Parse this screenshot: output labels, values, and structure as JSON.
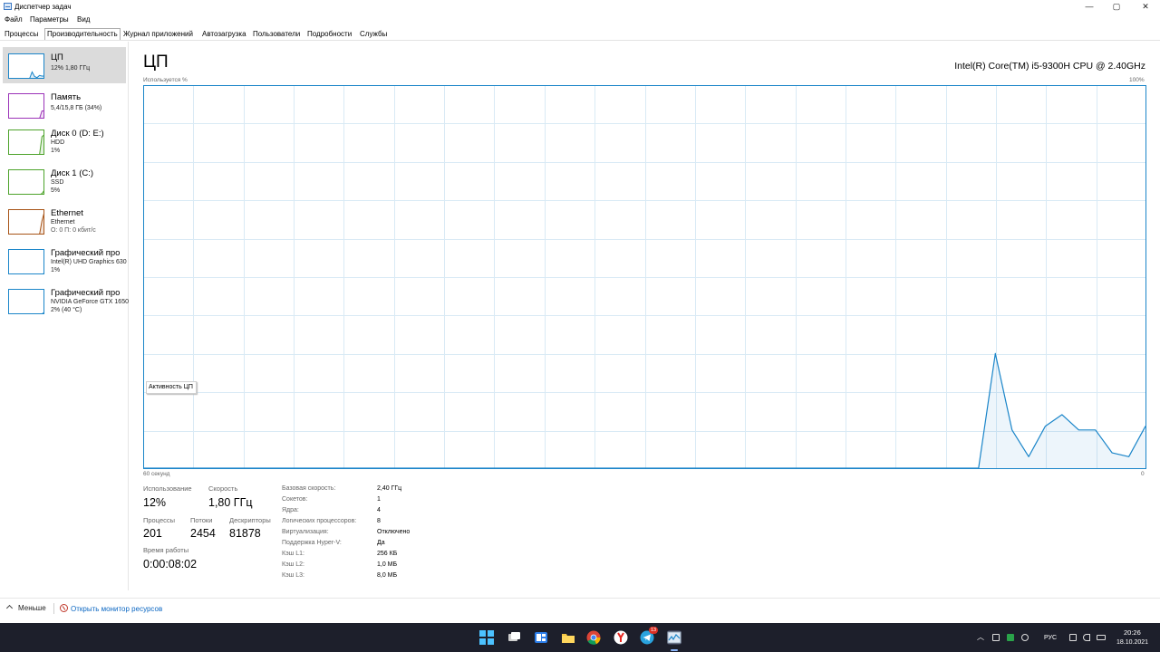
{
  "window": {
    "title": "Диспетчер задач",
    "controls": {
      "minimize": "—",
      "maximize": "▢",
      "close": "✕"
    }
  },
  "menu": [
    "Файл",
    "Параметры",
    "Вид"
  ],
  "tabs": [
    {
      "label": "Процессы",
      "active": false
    },
    {
      "label": "Производительность",
      "active": true
    },
    {
      "label": "Журнал приложений",
      "active": false
    },
    {
      "label": "Автозагрузка",
      "active": false
    },
    {
      "label": "Пользователи",
      "active": false
    },
    {
      "label": "Подробности",
      "active": false
    },
    {
      "label": "Службы",
      "active": false
    }
  ],
  "sidebar": {
    "items": [
      {
        "title": "ЦП",
        "sub1": "12% 1,80 ГГц",
        "sub2": "",
        "sub3": "",
        "color": "#1a85c9",
        "selected": true,
        "spark": [
          0,
          0,
          0,
          0,
          0,
          0,
          0,
          0,
          0.02,
          0.3,
          0.1,
          0.05,
          0.15,
          0.12,
          0.12
        ]
      },
      {
        "title": "Память",
        "sub1": "5,4/15,8 ГБ (34%)",
        "sub2": "",
        "sub3": "",
        "color": "#9b32b8",
        "selected": false,
        "spark": [
          0,
          0,
          0,
          0,
          0,
          0,
          0,
          0,
          0,
          0,
          0,
          0,
          0,
          0.34,
          0.34
        ]
      },
      {
        "title": "Диск 0 (D: E:)",
        "sub1": "HDD",
        "sub2": "1%",
        "sub3": "",
        "color": "#4da32a",
        "selected": false,
        "spark": [
          0,
          0,
          0,
          0,
          0,
          0,
          0,
          0,
          0,
          0,
          0,
          0,
          0,
          0.8,
          0.9
        ]
      },
      {
        "title": "Диск 1 (C:)",
        "sub1": "SSD",
        "sub2": "5%",
        "sub3": "",
        "color": "#4da32a",
        "selected": false,
        "spark": [
          0,
          0,
          0,
          0,
          0,
          0,
          0,
          0,
          0,
          0,
          0,
          0,
          0,
          0.05,
          0.2
        ]
      },
      {
        "title": "Ethernet",
        "sub1": "Ethernet",
        "sub2": "О: 0 П: 0 кбит/с",
        "sub3": "",
        "color": "#a75316",
        "selected": false,
        "spark": [
          0,
          0,
          0,
          0,
          0,
          0,
          0,
          0,
          0,
          0,
          0,
          0,
          0,
          0.6,
          1.0
        ]
      },
      {
        "title": "Графический про",
        "sub1": "Intel(R) UHD Graphics 630",
        "sub2": "1%",
        "sub3": "",
        "color": "#1a85c9",
        "selected": false,
        "spark": [
          0,
          0,
          0,
          0,
          0,
          0,
          0,
          0,
          0,
          0,
          0,
          0,
          0,
          0,
          0.05
        ]
      },
      {
        "title": "Графический про",
        "sub1": "NVIDIA GeForce GTX 1650",
        "sub2": "2% (40 °C)",
        "sub3": "",
        "color": "#1a85c9",
        "selected": false,
        "spark": [
          0,
          0,
          0,
          0,
          0,
          0,
          0,
          0,
          0,
          0,
          0,
          0,
          0,
          0.02,
          0.08
        ]
      }
    ]
  },
  "main": {
    "title": "ЦП",
    "cpu_model": "Intel(R) Core(TM) i5-9300H CPU @ 2.40GHz",
    "graph_top_left": "Используется %",
    "graph_top_right": "100%",
    "graph_bottom_left": "60 секунд",
    "graph_bottom_right": "0",
    "tooltip": "Активность ЦП",
    "accent": "#1a85c9",
    "grid_color": "#d9eaf5"
  },
  "chart_data": {
    "type": "area",
    "x": [
      60,
      59,
      58,
      57,
      56,
      55,
      54,
      53,
      52,
      51,
      50,
      49,
      48,
      47,
      46,
      45,
      44,
      43,
      42,
      41,
      40,
      39,
      38,
      37,
      36,
      35,
      34,
      33,
      32,
      31,
      30,
      29,
      28,
      27,
      26,
      25,
      24,
      23,
      22,
      21,
      20,
      19,
      18,
      17,
      16,
      15,
      14,
      13,
      12,
      11,
      10,
      9,
      8,
      7,
      6,
      5,
      4,
      3,
      2,
      1,
      0
    ],
    "series": [
      {
        "values": [
          0,
          0,
          0,
          0,
          0,
          0,
          0,
          0,
          0,
          0,
          0,
          0,
          0,
          0,
          0,
          0,
          0,
          0,
          0,
          0,
          0,
          0,
          0,
          0,
          0,
          0,
          0,
          0,
          0,
          0,
          0,
          0,
          0,
          0,
          0,
          0,
          0,
          0,
          0,
          0,
          0,
          0,
          0,
          0,
          0,
          0,
          0,
          0,
          0,
          0,
          0,
          30,
          10,
          3,
          11,
          14,
          10,
          10,
          4,
          3,
          11
        ]
      }
    ],
    "xlabel": "60 секунд",
    "ylabel": "Используется %",
    "ylim": [
      0,
      100
    ],
    "grid": true
  },
  "stats": {
    "usage_label": "Использование",
    "usage_value": "12%",
    "speed_label": "Скорость",
    "speed_value": "1,80 ГГц",
    "processes_label": "Процессы",
    "processes_value": "201",
    "threads_label": "Потоки",
    "threads_value": "2454",
    "handles_label": "Дескрипторы",
    "handles_value": "81878",
    "uptime_label": "Время работы",
    "uptime_value": "0:00:08:02"
  },
  "details": [
    {
      "key": "Базовая скорость:",
      "value": "2,40 ГГц"
    },
    {
      "key": "Сокетов:",
      "value": "1"
    },
    {
      "key": "Ядра:",
      "value": "4"
    },
    {
      "key": "Логических процессоров:",
      "value": "8"
    },
    {
      "key": "Виртуализация:",
      "value": "Отключено"
    },
    {
      "key": "Поддержка Hyper-V:",
      "value": "Да"
    },
    {
      "key": "Кэш L1:",
      "value": "256 КБ"
    },
    {
      "key": "Кэш L2:",
      "value": "1,0 МБ"
    },
    {
      "key": "Кэш L3:",
      "value": "8,0 МБ"
    }
  ],
  "footer": {
    "less_label": "Меньше",
    "resmon_label": "Открыть монитор ресурсов"
  },
  "taskbar": {
    "apps": [
      "windows-start-icon",
      "task-view-icon",
      "widgets-icon",
      "file-explorer-icon",
      "chrome-icon",
      "yandex-browser-icon",
      "telegram-icon",
      "task-manager-icon"
    ],
    "telegram_badge": "13",
    "language": "РУС",
    "time": "20:26",
    "date": "18.10.2021"
  }
}
